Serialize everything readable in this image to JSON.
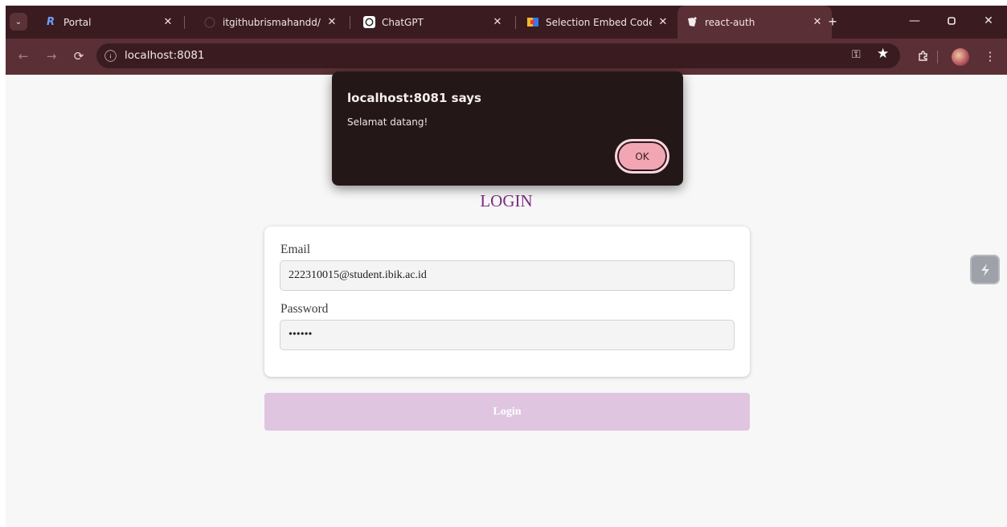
{
  "tabs": [
    {
      "title": "Portal",
      "icon": "portal-r-logo"
    },
    {
      "title": "itgithubrismahandd/PPB",
      "icon": "github-icon"
    },
    {
      "title": "ChatGPT",
      "icon": "chatgpt-icon"
    },
    {
      "title": "Selection Embed Code - ",
      "icon": "colorful-logo-icon"
    },
    {
      "title": "react-auth",
      "icon": "react-icon",
      "active": true
    }
  ],
  "omnibox": {
    "url": "localhost:8081"
  },
  "page": {
    "heading": "LOGIN",
    "email_label": "Email",
    "email_value": "222310015@student.ibik.ac.id",
    "password_label": "Password",
    "password_value": "••••••",
    "login_button": "Login"
  },
  "alert": {
    "title": "localhost:8081 says",
    "message": "Selamat datang!",
    "ok_label": "OK"
  },
  "colors": {
    "chrome_dark": "#3a1c20",
    "chrome_toolbar": "#5a2f35",
    "heading": "#7b2c82",
    "login_button": "#dfc5e0",
    "alert_bg": "#231718",
    "ok_button": "#f2a6b4"
  }
}
